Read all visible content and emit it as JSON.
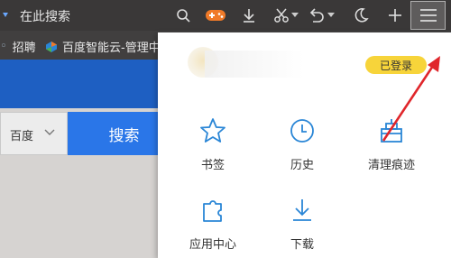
{
  "toolbar": {
    "search_text": "在此搜索",
    "icons": [
      "search-icon",
      "gamepad-icon",
      "download-icon",
      "scissors-icon",
      "undo-icon",
      "moon-icon",
      "plus-icon",
      "menu-icon"
    ]
  },
  "bookmarks": {
    "items": [
      {
        "label": "招聘"
      },
      {
        "label": "百度智能云-管理中"
      }
    ]
  },
  "page": {
    "select_label": "百度",
    "search_button": "搜索"
  },
  "menu": {
    "login_badge": "已登录",
    "items": [
      {
        "label": "书签",
        "icon": "star-icon"
      },
      {
        "label": "历史",
        "icon": "clock-icon"
      },
      {
        "label": "清理痕迹",
        "icon": "broom-icon"
      },
      {
        "label": "应用中心",
        "icon": "puzzle-icon"
      },
      {
        "label": "下载",
        "icon": "download-icon"
      }
    ]
  },
  "colors": {
    "accent_blue": "#2a86d6",
    "toolbar_bg": "#3a3838",
    "badge_yellow": "#f7d43a",
    "arrow_red": "#e0262b",
    "game_orange": "#f07a28"
  }
}
